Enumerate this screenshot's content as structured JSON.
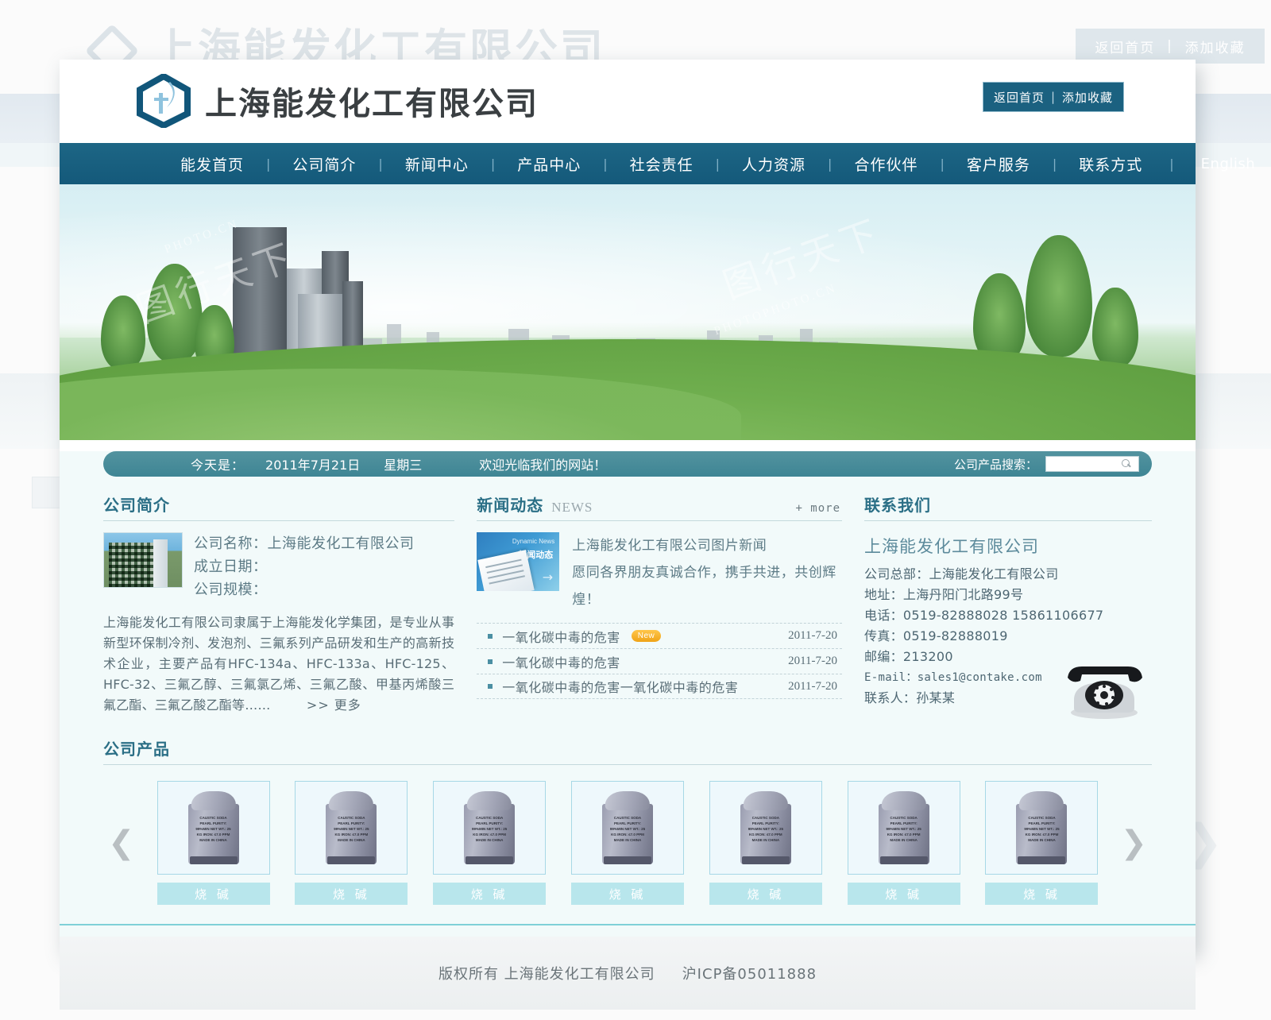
{
  "brand": {
    "company_name": "上海能发化工有限公司",
    "logo_icon": "hexagon-leaf-logo"
  },
  "topbar": {
    "home_label": "返回首页",
    "separator": "|",
    "favorite_label": "添加收藏"
  },
  "nav": {
    "items": [
      {
        "label": "能发首页"
      },
      {
        "label": "公司简介"
      },
      {
        "label": "新闻中心"
      },
      {
        "label": "产品中心"
      },
      {
        "label": "社会责任"
      },
      {
        "label": "人力资源"
      },
      {
        "label": "合作伙伴"
      },
      {
        "label": "客户服务"
      },
      {
        "label": "联系方式"
      },
      {
        "label": "English"
      }
    ],
    "divider": "|"
  },
  "banner": {
    "watermark_small": "PHOTO.CN",
    "watermark_big": "图行天下",
    "watermark_site": "PHOTOPHOTO.CN"
  },
  "datebar": {
    "today_label": "今天是：",
    "date": "2011年7月21日",
    "weekday": "星期三",
    "welcome": "欢迎光临我们的网站！",
    "search_label": "公司产品搜索：",
    "search_value": "",
    "search_placeholder": "",
    "search_icon": "magnifier-icon"
  },
  "about": {
    "title": "公司简介",
    "thumb_icon": "company-building-photo",
    "field_name": "公司名称：上海能发化工有限公司",
    "field_founded": "成立日期：",
    "field_scale": "公司规模：",
    "body": "上海能发化工有限公司隶属于上海能发化学集团，是专业从事新型环保制冷剂、发泡剂、三氟系列产品研发和生产的高新技术企业，主要产品有HFC-134a、HFC-133a、HFC-125、HFC-32、三氟乙醇、三氟氯乙烯、三氟乙酸、甲基丙烯酸三氟乙酯、三氟乙酸乙酯等……",
    "more_label": ">> 更多"
  },
  "news": {
    "title": "新闻动态",
    "subtitle": "NEWS",
    "more_label": "+ more",
    "thumb_icon": "newspaper-photo",
    "thumb_caption_en": "Dynamic News",
    "thumb_caption_cn": "新闻动态",
    "feature_line1": "上海能发化工有限公司图片新闻",
    "feature_line2": "愿同各界朋友真诚合作，携手共进，共创辉煌！",
    "items": [
      {
        "title": "一氧化碳中毒的危害",
        "badge": "New",
        "date": "2011-7-20"
      },
      {
        "title": "一氧化碳中毒的危害",
        "badge": "",
        "date": "2011-7-20"
      },
      {
        "title": "一氧化碳中毒的危害一氧化碳中毒的危害",
        "badge": "",
        "date": "2011-7-20"
      }
    ]
  },
  "contact": {
    "title": "联系我们",
    "company": "上海能发化工有限公司",
    "headquarters": "公司总部：上海能发化工有限公司",
    "address": "地址：上海丹阳门北路99号",
    "phone": "电话：0519-82888028  15861106677",
    "fax": "传真：0519-82888019",
    "zip": "邮编：213200",
    "email": "E-mail：sales1@contake.com",
    "person": "联系人：孙某某",
    "phone_icon": "telephone-icon"
  },
  "products": {
    "title": "公司产品",
    "prev_icon": "chevron-left-icon",
    "next_icon": "chevron-right-icon",
    "bag_text": "CAUSTIC SODA PEARL\nPURITY: 99%MIN\nNET WT.: 25 KG\nIRON: ≤7.0 PPM\nMADE IN CHINA",
    "items": [
      {
        "label": "烧 碱"
      },
      {
        "label": "烧 碱"
      },
      {
        "label": "烧 碱"
      },
      {
        "label": "烧 碱"
      },
      {
        "label": "烧 碱"
      },
      {
        "label": "烧 碱"
      },
      {
        "label": "烧 碱"
      }
    ]
  },
  "footer": {
    "copyright": "版权所有  上海能发化工有限公司",
    "icp": "沪ICP备05011888"
  },
  "colors": {
    "nav_blue": "#14597a",
    "accent_teal": "#2b6f86",
    "datebar": "#3e8594",
    "label_bg": "#b8e6ec",
    "badge_orange": "#f0a317"
  }
}
